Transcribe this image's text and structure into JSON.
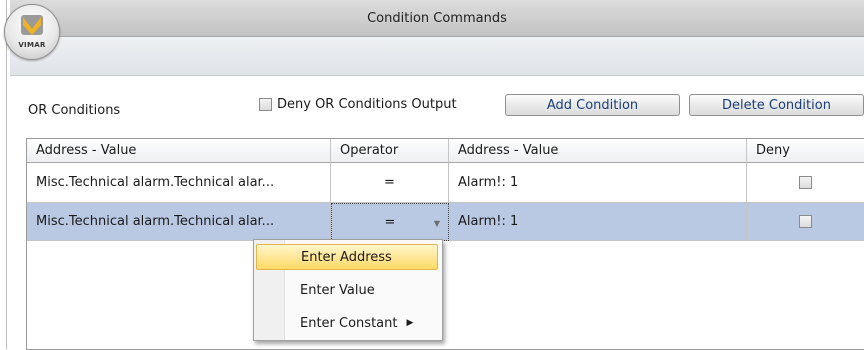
{
  "window": {
    "title": "Condition Commands"
  },
  "logo": {
    "text": "VIMAR",
    "color": "#f0b323"
  },
  "toolbar": {
    "or_label": "OR Conditions",
    "deny_or_label": "Deny OR Conditions Output",
    "deny_or_checked": false,
    "add_button": "Add Condition",
    "delete_button": "Delete Condition"
  },
  "table": {
    "headers": [
      "Address - Value",
      "Operator",
      "Address - Value",
      "Deny"
    ],
    "rows": [
      {
        "address": "Misc.Technical alarm.Technical alar...",
        "operator": "=",
        "value": "Alarm!: 1",
        "deny": false
      },
      {
        "address": "Misc.Technical alarm.Technical alar...",
        "operator": "=",
        "value": "Alarm!: 1",
        "deny": false,
        "selected": true
      }
    ]
  },
  "context_menu": {
    "items": [
      "Enter Address",
      "Enter Value",
      "Enter Constant"
    ],
    "highlighted": "Enter Address",
    "submenu_icon": "triangle-right-icon"
  },
  "colors": {
    "selected_row": "#b9c8e3",
    "menu_highlight": "#ffd966",
    "button_text": "#1a3e7a"
  }
}
